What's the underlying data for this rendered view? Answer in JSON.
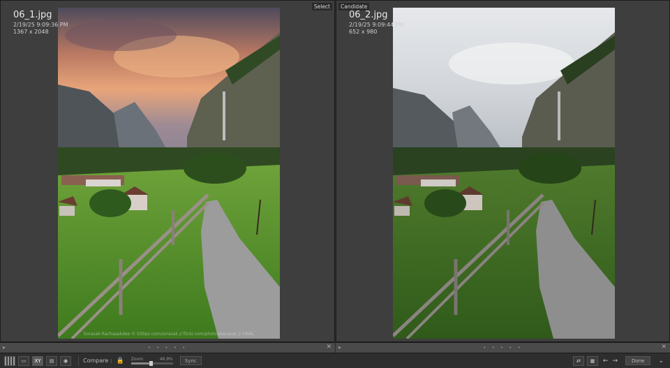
{
  "left_pane": {
    "tag": "Select",
    "filename": "06_1.jpg",
    "datetime": "2/19/25 9:09:36 PM",
    "dimensions": "1367 x 2048",
    "watermark": "Sorasak Rachapakdee © 500px.com/sorasak // flickr.com/photos/sorasak // FINAL"
  },
  "right_pane": {
    "tag": "Candidate",
    "filename": "06_2.jpg",
    "datetime": "2/19/25 9:09:44 PM",
    "dimensions": "652 x 980"
  },
  "toolbar": {
    "compare_label": "Compare :",
    "zoom_label": "Zoom",
    "zoom_value": "46.9%",
    "zoom_fraction": 0.469,
    "sync_label": "Sync",
    "done_label": "Done",
    "view_xy_label": "XY"
  },
  "colors": {
    "panel_bg": "#3e3e3e",
    "toolbar_bg": "#2e2e2e",
    "sky_sunset_top": "#5a4a58",
    "sky_sunset_glow": "#e89a6a",
    "sky_cloudy": "#dfe2e6",
    "grass": "#5f9a2e",
    "path": "#9a9a9a"
  },
  "icons": [
    "grid-icon",
    "loupe-icon",
    "compare-icon",
    "survey-icon",
    "people-icon",
    "lock-icon",
    "close-icon",
    "arrow-left-icon",
    "arrow-right-icon",
    "chevron-down-icon"
  ]
}
